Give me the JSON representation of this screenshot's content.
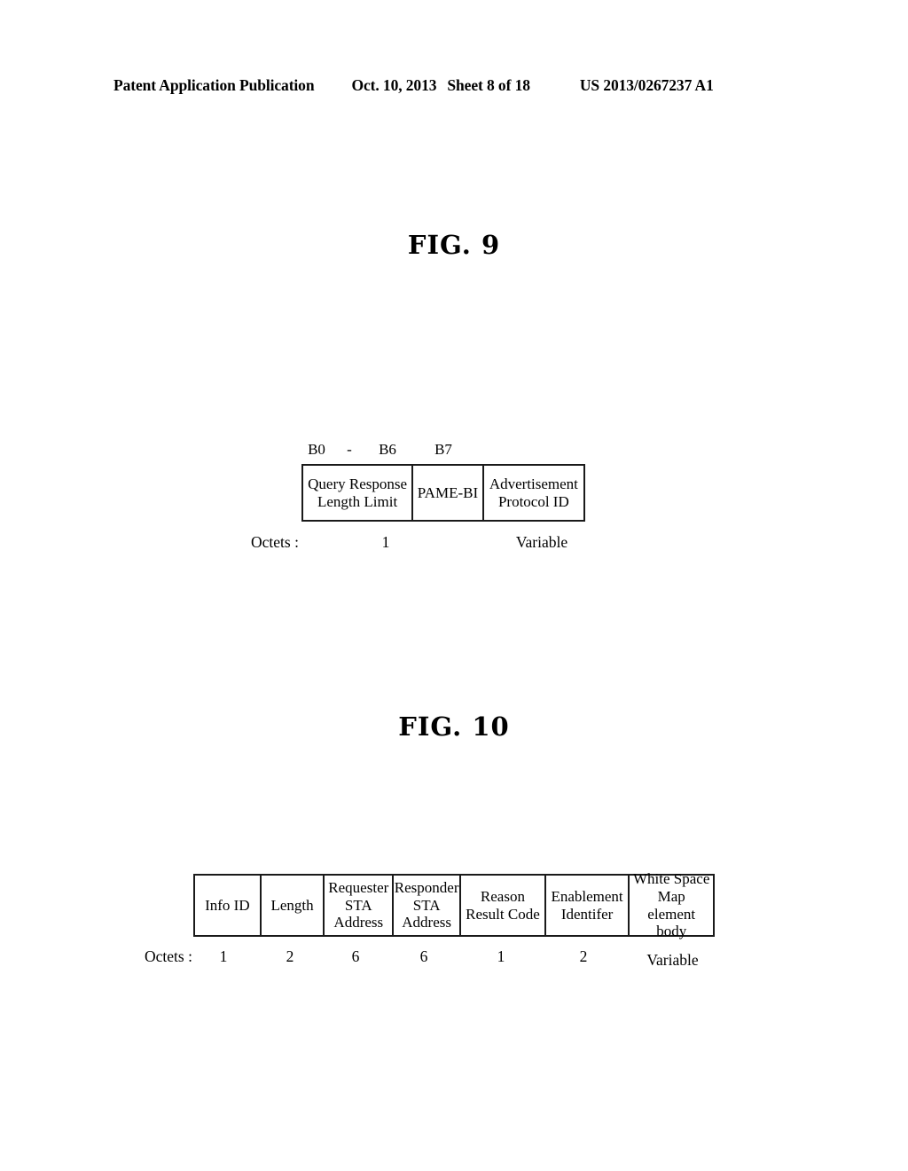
{
  "header": {
    "publication": "Patent Application Publication",
    "date": "Oct. 10, 2013",
    "sheet": "Sheet 8 of 18",
    "patent_number": "US 2013/0267237 A1"
  },
  "figures": [
    {
      "title": "FIG. 9",
      "bit_labels": {
        "start": "B0",
        "dash": "-",
        "end": "B6",
        "last": "B7"
      },
      "fields": [
        {
          "label": "Query Response Length Limit"
        },
        {
          "label": "PAME-BI"
        },
        {
          "label": "Advertisement Protocol ID"
        }
      ],
      "octets_label": "Octets :",
      "octets": [
        "1",
        "Variable"
      ]
    },
    {
      "title": "FIG. 10",
      "fields": [
        {
          "label": "Info ID"
        },
        {
          "label": "Length"
        },
        {
          "label": "Requester STA Address"
        },
        {
          "label": "Responder STA Address"
        },
        {
          "label": "Reason Result Code"
        },
        {
          "label": "Enablement Identifer"
        },
        {
          "label": "White Space Map element body"
        }
      ],
      "octets_label": "Octets :",
      "octets": [
        "1",
        "2",
        "6",
        "6",
        "1",
        "2",
        "Variable"
      ]
    }
  ]
}
